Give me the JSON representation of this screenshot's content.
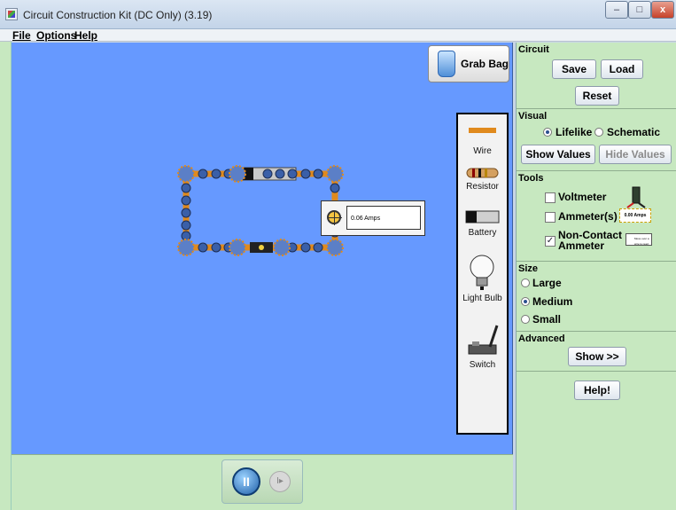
{
  "window": {
    "title": "Circuit Construction Kit (DC Only) (3.19)",
    "min_label": "–",
    "max_label": "□",
    "close_label": "x"
  },
  "menu": {
    "file": "File",
    "options": "Options",
    "help": "Help"
  },
  "canvas": {
    "grab_bag_label": "Grab Bag",
    "ammeter_reading": "0.06 Amps"
  },
  "toolbox": {
    "items": [
      "Wire",
      "Resistor",
      "Battery",
      "Light Bulb",
      "Switch"
    ]
  },
  "playback": {
    "pause_label": "II",
    "step_label": "I▸"
  },
  "panel": {
    "circuit": {
      "title": "Circuit",
      "save": "Save",
      "load": "Load",
      "reset": "Reset"
    },
    "visual": {
      "title": "Visual",
      "lifelike": "Lifelike",
      "schematic": "Schematic",
      "selected": "Lifelike",
      "show_values": "Show Values",
      "hide_values": "Hide Values"
    },
    "tools": {
      "title": "Tools",
      "voltmeter": "Voltmeter",
      "ammeters": "Ammeter(s)",
      "ammeter_thumb": "0.00 Amps",
      "noncontact_line1": "Non-Contact",
      "noncontact_line2": "Ammeter",
      "noncontact_thumb": "Move over a wire to read current",
      "voltmeter_checked": false,
      "ammeters_checked": false,
      "noncontact_checked": true
    },
    "size": {
      "title": "Size",
      "large": "Large",
      "medium": "Medium",
      "small": "Small",
      "selected": "Medium"
    },
    "advanced": {
      "title": "Advanced",
      "show": "Show >>"
    },
    "help": "Help!"
  },
  "colors": {
    "canvas_bg": "#6699ff",
    "panel_bg": "#c7e8c0",
    "wire": "#e08a1e",
    "junction": "#3a5fa8"
  }
}
